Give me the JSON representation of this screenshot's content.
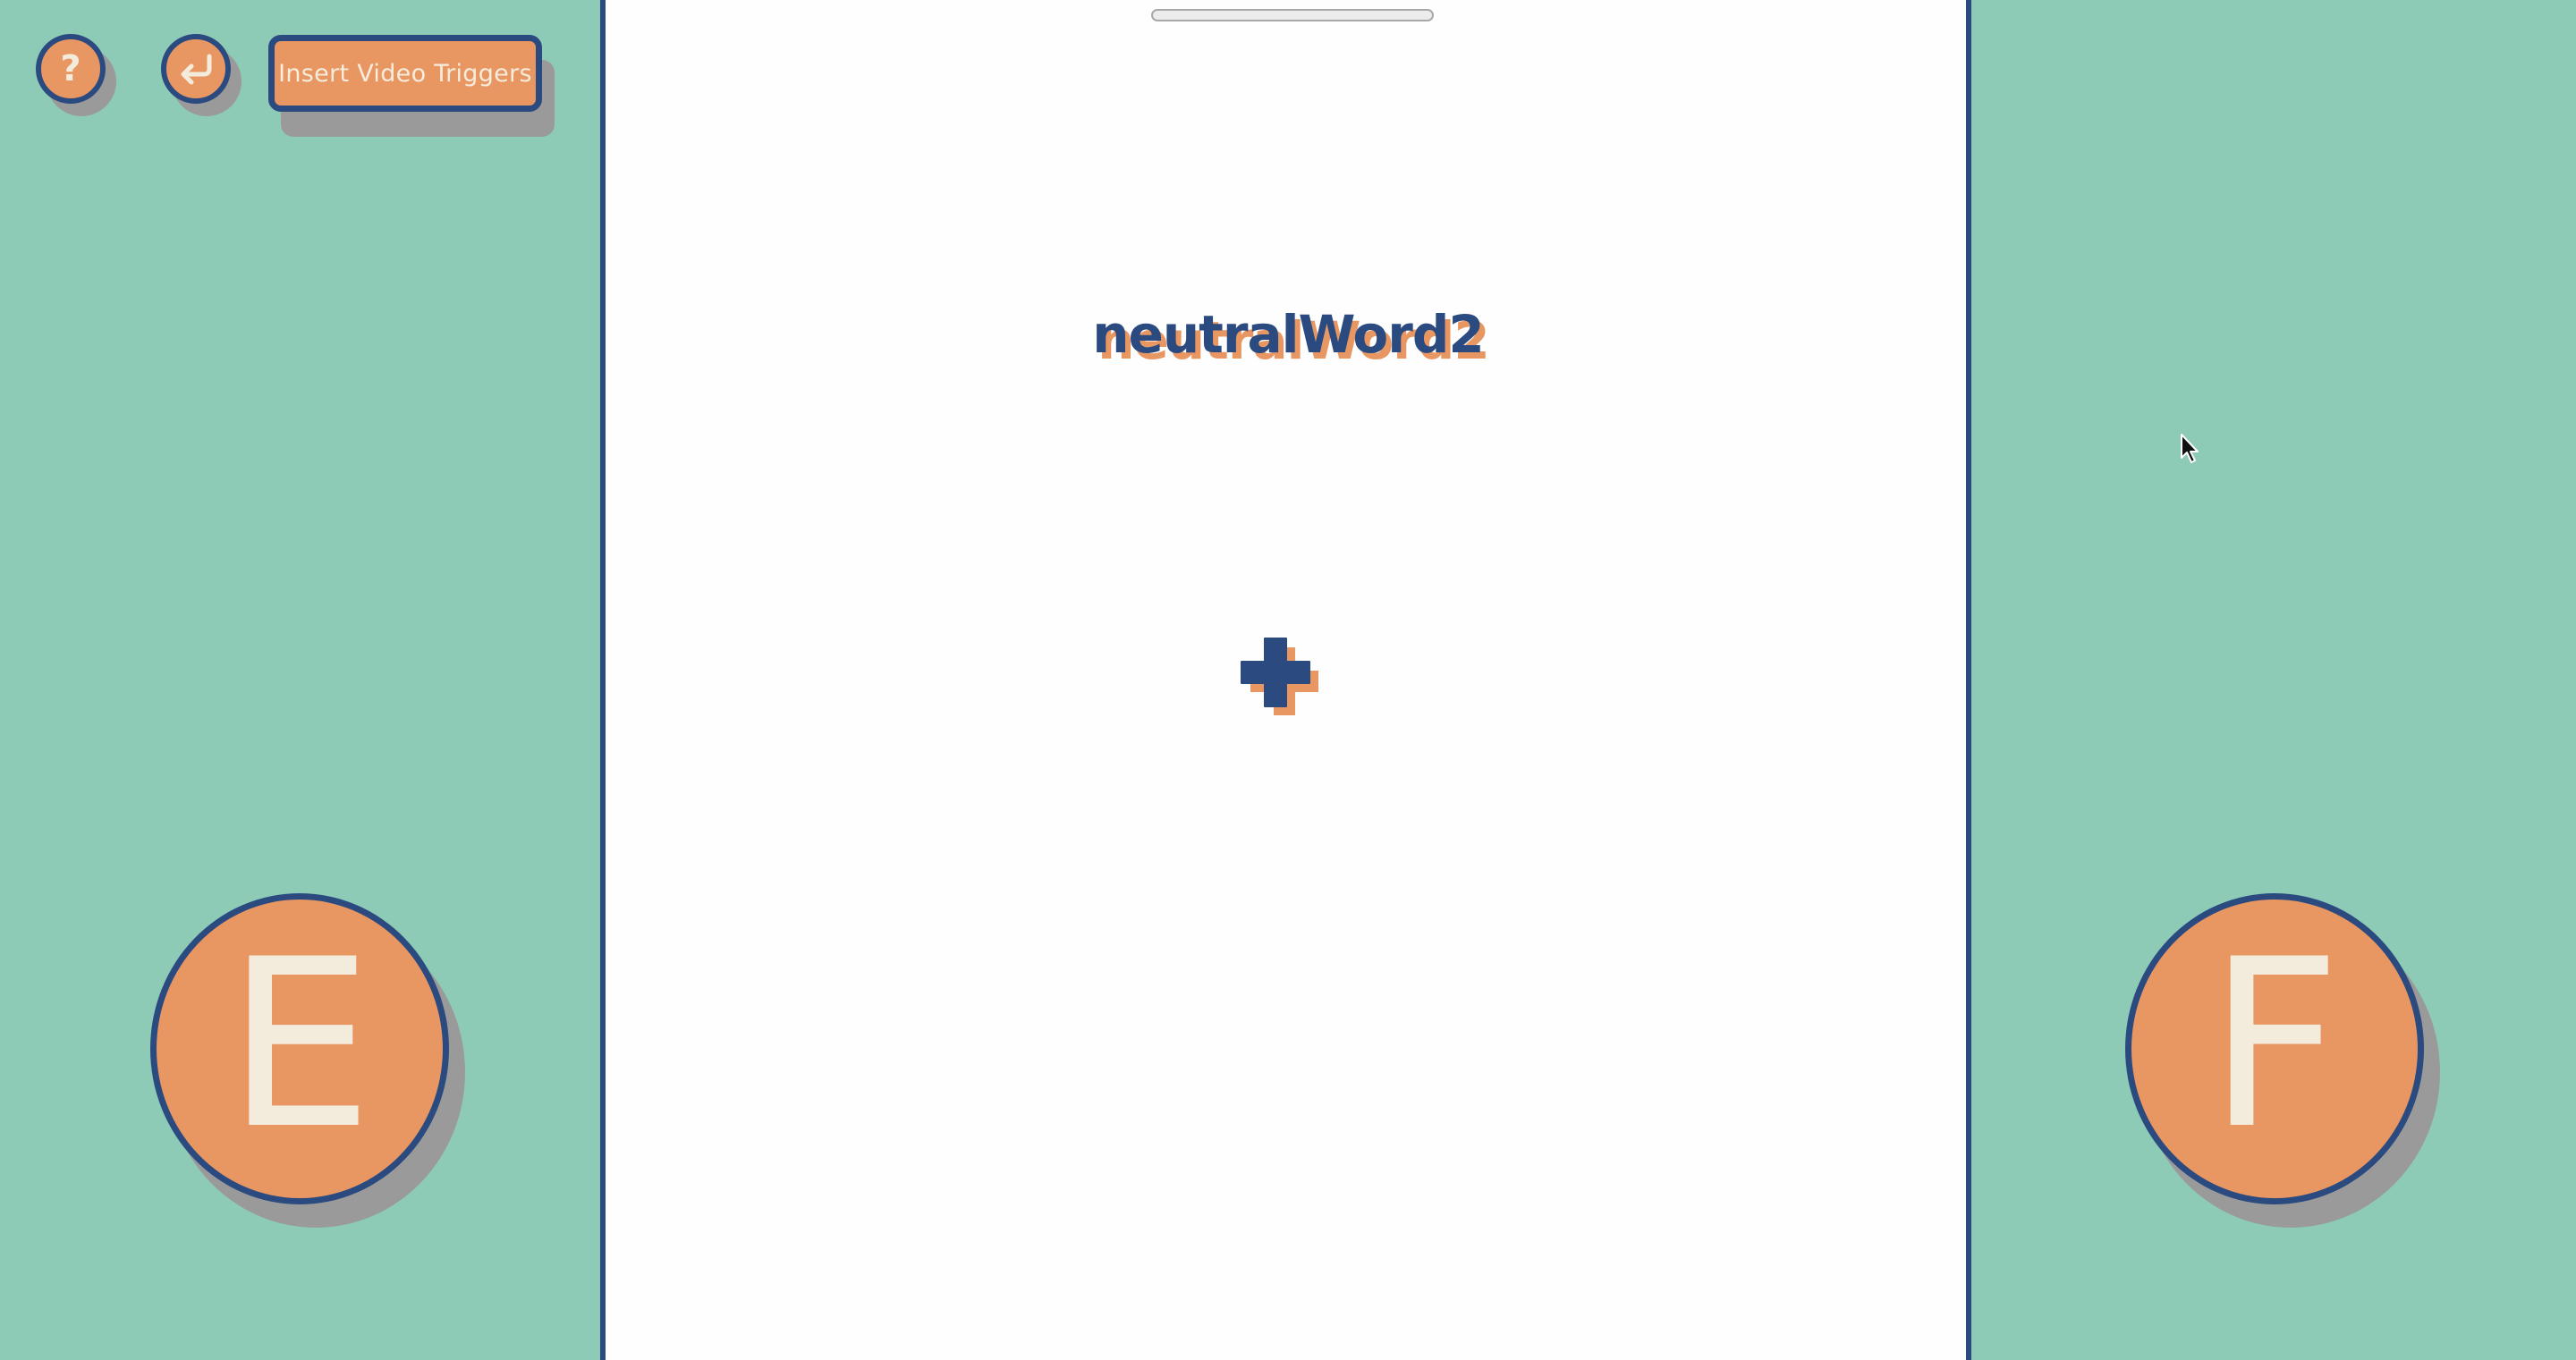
{
  "toolbar": {
    "help_glyph": "?",
    "back_icon": "return-arrow-icon",
    "insert_button_label": "Insert Video Triggers"
  },
  "stimulus": {
    "word": "neutralWord2",
    "fixation_icon": "plus-cross-icon"
  },
  "response_keys": {
    "left_key": "E",
    "right_key": "F"
  },
  "colors": {
    "background": "#8ecbb7",
    "stage": "#fefefe",
    "accent_orange": "#e99762",
    "navy": "#2a4a80",
    "shadow_gray": "#9a9a9a",
    "cream_text": "#f3ebdc"
  }
}
